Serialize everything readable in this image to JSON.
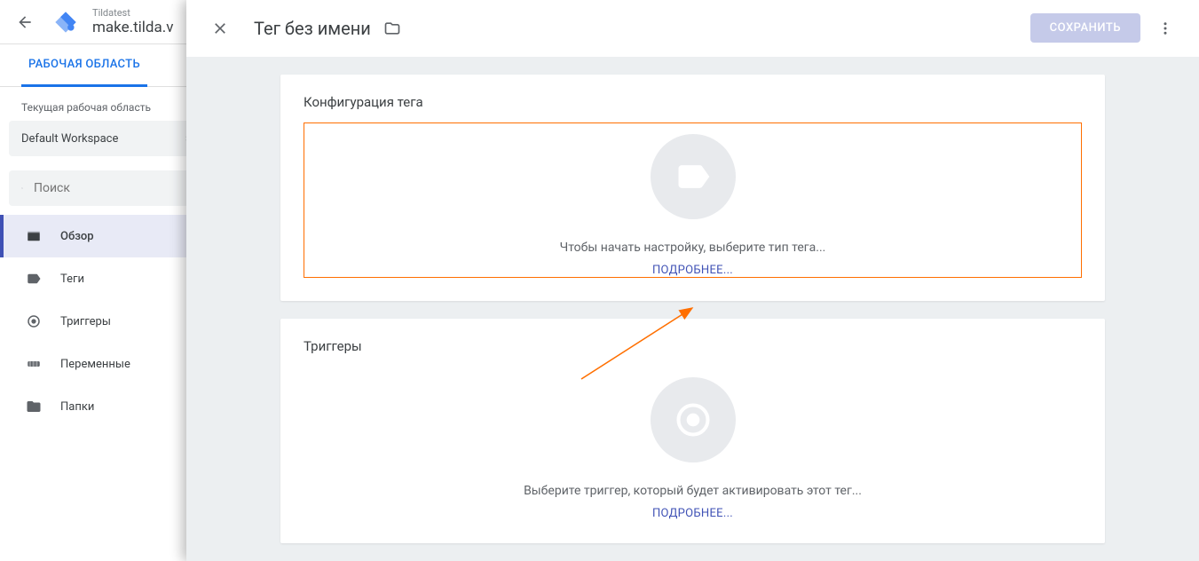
{
  "header": {
    "account_name": "Tildatest",
    "container_name": "make.tilda.v"
  },
  "tabs": {
    "workspace": "РАБОЧАЯ ОБЛАСТЬ"
  },
  "sidebar": {
    "current_workspace_label": "Текущая рабочая область",
    "workspace_name": "Default Workspace",
    "search_placeholder": "Поиск",
    "nav": {
      "overview": "Обзор",
      "tags": "Теги",
      "triggers": "Триггеры",
      "variables": "Переменные",
      "folders": "Папки"
    }
  },
  "modal": {
    "title": "Тег без имени",
    "save_label": "СОХРАНИТЬ",
    "config_card": {
      "title": "Конфигурация тега",
      "prompt": "Чтобы начать настройку, выберите тип тега...",
      "link": "ПОДРОБНЕЕ..."
    },
    "triggers_card": {
      "title": "Триггеры",
      "prompt": "Выберите триггер, который будет активировать этот тег...",
      "link": "ПОДРОБНЕЕ..."
    }
  }
}
